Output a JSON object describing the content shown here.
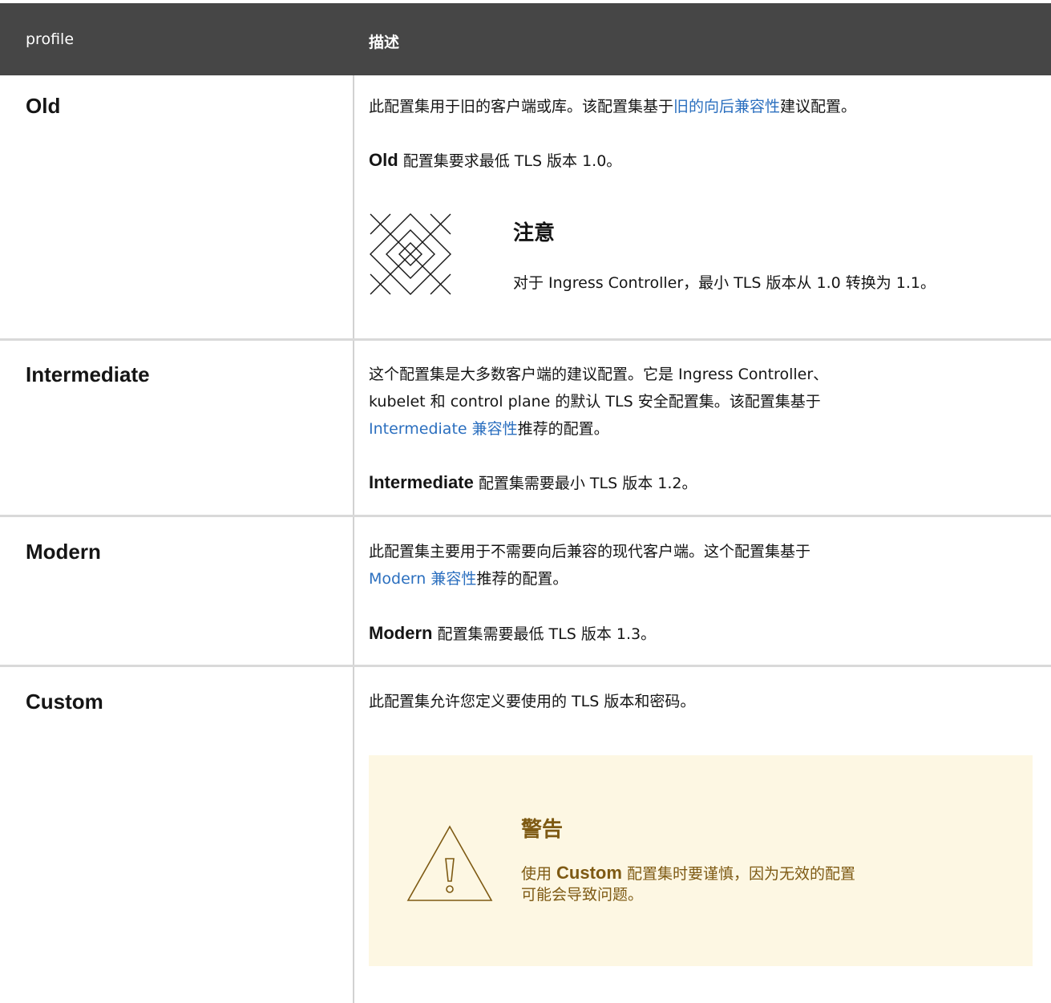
{
  "header": {
    "col_profile": "profile",
    "col_desc": "描述"
  },
  "rows": {
    "old": {
      "name": "Old",
      "line1_a": "此配置集用于旧的客户端或库。该配置集基于",
      "line1_link": "旧的向后兼容性",
      "line1_b": "建议配置。",
      "min_bold": "Old",
      "min_text": " 配置集要求最低 TLS 版本 1.0。",
      "note_title": "注意",
      "note_body": "对于 Ingress Controller，最小 TLS 版本从 1.0 转换为 1.1。"
    },
    "intermediate": {
      "name": "Intermediate",
      "line1": "这个配置集是大多数客户端的建议配置。它是 Ingress Controller、",
      "line2": "kubelet 和 control plane 的默认 TLS 安全配置集。该配置集基于",
      "line3_link": "Intermediate 兼容性",
      "line3_b": "推荐的配置。",
      "min_bold": "Intermediate",
      "min_text": " 配置集需要最小 TLS 版本 1.2。"
    },
    "modern": {
      "name": "Modern",
      "line1": "此配置集主要用于不需要向后兼容的现代客户端。这个配置集基于",
      "line2_link": "Modern 兼容性",
      "line2_b": "推荐的配置。",
      "min_bold": "Modern",
      "min_text": " 配置集需要最低 TLS 版本 1.3。"
    },
    "custom": {
      "name": "Custom",
      "line1": "此配置集允许您定义要使用的 TLS 版本和密码。",
      "warn_title": "警告",
      "warn_a": "使用 ",
      "warn_bold": "Custom",
      "warn_b": " 配置集时要谨慎，因为无效的配置",
      "warn_c": "可能会导致问题。"
    }
  },
  "colors": {
    "header_bg": "#464646",
    "link": "#2b6fbf",
    "warning_bg": "#fdf7e3",
    "warning_text": "#7e5a13"
  },
  "icons": {
    "note": "note-lattice-icon",
    "warning": "warning-triangle-icon"
  }
}
